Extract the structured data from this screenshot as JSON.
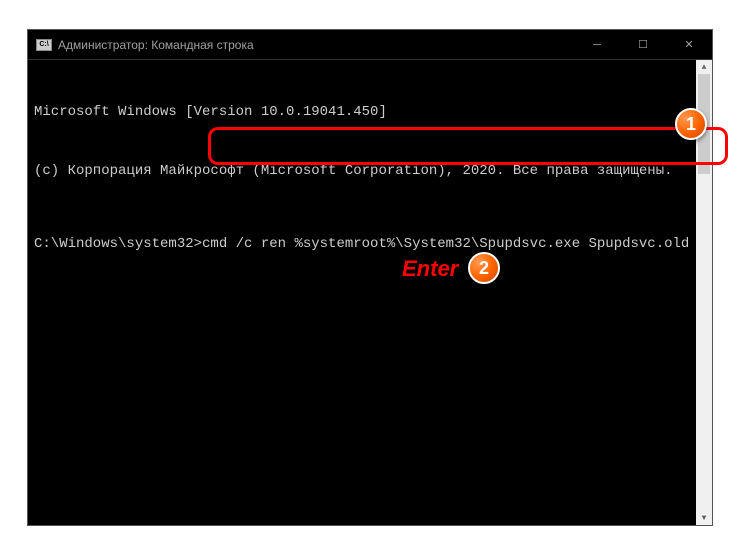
{
  "titlebar": {
    "icon_text": "C:\\",
    "title": "Администратор: Командная строка"
  },
  "window_controls": {
    "minimize": "─",
    "maximize": "☐",
    "close": "✕"
  },
  "terminal": {
    "line1": "Microsoft Windows [Version 10.0.19041.450]",
    "line2": "(c) Корпорация Майкрософт (Microsoft Corporation), 2020. Все права защищены.",
    "prompt": "C:\\Windows\\system32>",
    "command": "cmd /c ren %systemroot%\\System32\\Spupdsvc.exe Spupdsvc.old"
  },
  "annotations": {
    "badge1": "1",
    "badge2": "2",
    "enter_label": "Enter"
  },
  "scrollbar": {
    "up_arrow": "▲",
    "down_arrow": "▼"
  }
}
